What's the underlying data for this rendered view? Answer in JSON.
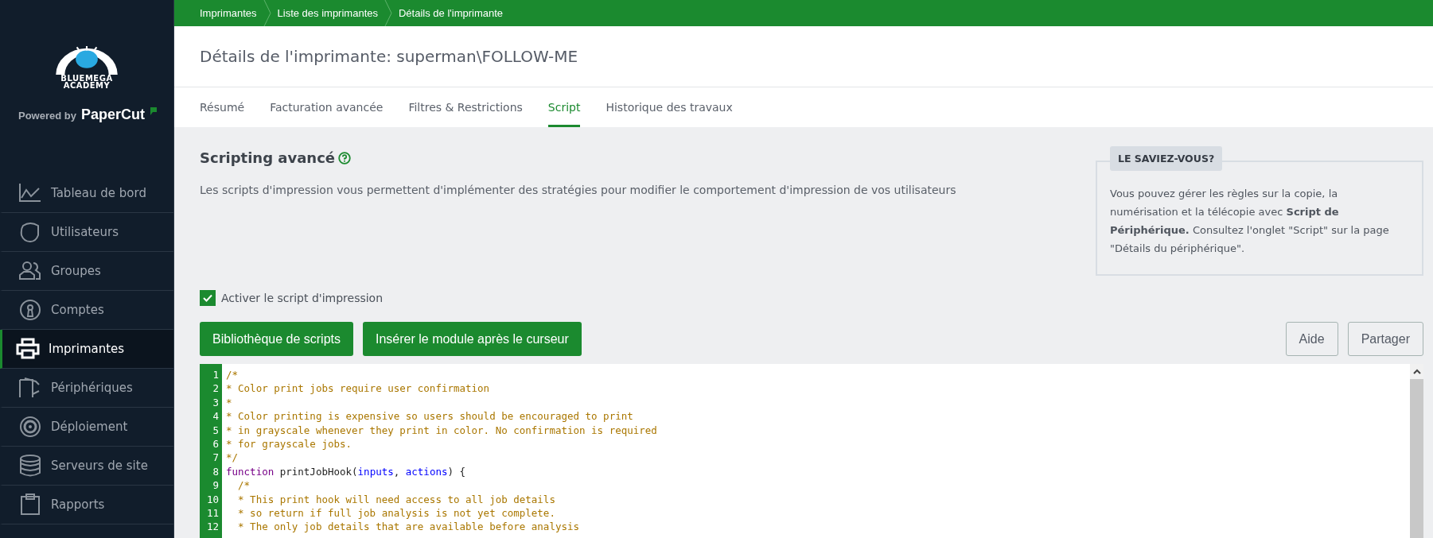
{
  "sidebar": {
    "logo_text": [
      "BLUEMEGA",
      "ACADEMY"
    ],
    "powered_by": "Powered by",
    "brand": "PaperCut",
    "items": [
      {
        "label": "Tableau de bord",
        "selected": false
      },
      {
        "label": "Utilisateurs",
        "selected": false
      },
      {
        "label": "Groupes",
        "selected": false
      },
      {
        "label": "Comptes",
        "selected": false
      },
      {
        "label": "Imprimantes",
        "selected": true
      },
      {
        "label": "Périphériques",
        "selected": false
      },
      {
        "label": "Déploiement",
        "selected": false
      },
      {
        "label": "Serveurs de site",
        "selected": false
      },
      {
        "label": "Rapports",
        "selected": false
      }
    ]
  },
  "breadcrumbs": [
    "Imprimantes",
    "Liste des imprimantes",
    "Détails de l'imprimante"
  ],
  "page_title": "Détails de l'imprimante: superman\\FOLLOW-ME",
  "tabs": [
    {
      "label": "Résumé",
      "selected": false
    },
    {
      "label": "Facturation avancée",
      "selected": false
    },
    {
      "label": "Filtres & Restrictions",
      "selected": false
    },
    {
      "label": "Script",
      "selected": true
    },
    {
      "label": "Historique des travaux",
      "selected": false
    }
  ],
  "section": {
    "title": "Scripting avancé",
    "description": "Les scripts d'impression vous permettent d'implémenter des stratégies pour modifier le comportement d'impression de vos utilisateurs"
  },
  "tip": {
    "title": "LE SAVIEZ-VOUS?",
    "text": "Vous pouvez gérer les règles sur la copie, la numérisation et la télécopie avec **Script de Périphérique.** Consultez l'onglet \"Script\" sur la page \"Détails du périphérique\"."
  },
  "enable_checkbox": {
    "label": "Activer le script d'impression",
    "checked": true
  },
  "primary_buttons": [
    "Bibliothèque de scripts",
    "Insérer le module après le curseur"
  ],
  "secondary_buttons": [
    "Aide",
    "Partager"
  ],
  "code": [
    {
      "number": "1",
      "segments": [
        {
          "kind": "comment",
          "text": "/*"
        }
      ]
    },
    {
      "number": "2",
      "segments": [
        {
          "kind": "comment",
          "text": "* Color print jobs require user confirmation"
        }
      ]
    },
    {
      "number": "3",
      "segments": [
        {
          "kind": "comment",
          "text": "*"
        }
      ]
    },
    {
      "number": "4",
      "segments": [
        {
          "kind": "comment",
          "text": "* Color printing is expensive so users should be encouraged to print"
        }
      ]
    },
    {
      "number": "5",
      "segments": [
        {
          "kind": "comment",
          "text": "* in grayscale whenever they print in color. No confirmation is required"
        }
      ]
    },
    {
      "number": "6",
      "segments": [
        {
          "kind": "comment",
          "text": "* for grayscale jobs."
        }
      ]
    },
    {
      "number": "7",
      "segments": [
        {
          "kind": "comment",
          "text": "*/"
        }
      ]
    },
    {
      "number": "8",
      "segments": [
        {
          "kind": "keyword",
          "text": "function"
        },
        {
          "kind": "plain",
          "text": " printJobHook("
        },
        {
          "kind": "variable",
          "text": "inputs"
        },
        {
          "kind": "plain",
          "text": ", "
        },
        {
          "kind": "variable",
          "text": "actions"
        },
        {
          "kind": "plain",
          "text": ") {"
        }
      ]
    },
    {
      "number": "9",
      "segments": [
        {
          "kind": "comment",
          "text": "  /*"
        }
      ]
    },
    {
      "number": "10",
      "segments": [
        {
          "kind": "comment",
          "text": "  * This print hook will need access to all job details"
        }
      ]
    },
    {
      "number": "11",
      "segments": [
        {
          "kind": "comment",
          "text": "  * so return if full job analysis is not yet complete."
        }
      ]
    },
    {
      "number": "12",
      "segments": [
        {
          "kind": "comment",
          "text": "  * The only job details that are available before analysis"
        }
      ]
    }
  ]
}
